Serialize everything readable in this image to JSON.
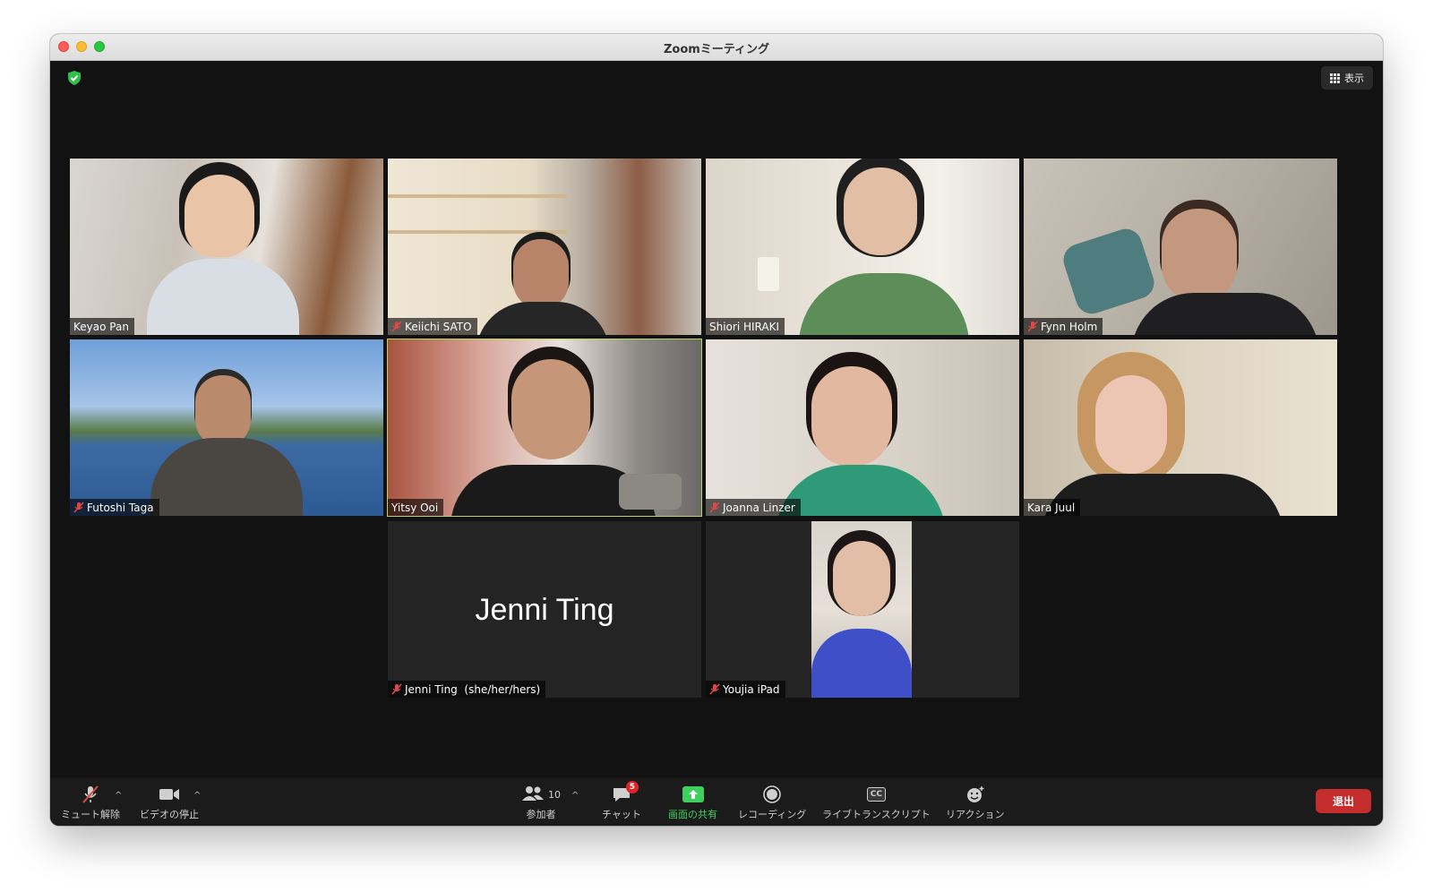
{
  "window": {
    "title": "Zoomミーティング"
  },
  "top": {
    "view_label": "表示"
  },
  "participants_tiles": [
    {
      "name": "Keyao Pan",
      "muted": false
    },
    {
      "name": "Keiichi SATO",
      "muted": true
    },
    {
      "name": "Shiori HIRAKI",
      "muted": false
    },
    {
      "name": "Fynn Holm",
      "muted": true
    },
    {
      "name": "Futoshi Taga",
      "muted": true
    },
    {
      "name": "Yitsy Ooi",
      "muted": false,
      "speaking": true
    },
    {
      "name": "Joanna Linzer",
      "muted": true
    },
    {
      "name": "Kara Juul",
      "muted": false
    },
    {
      "name": "Jenni Ting  (she/her/hers)",
      "display_name": "Jenni Ting",
      "muted": true,
      "video_off": true
    },
    {
      "name": "Youjia iPad",
      "muted": true
    }
  ],
  "toolbar": {
    "unmute": "ミュート解除",
    "stop_video": "ビデオの停止",
    "participants": "参加者",
    "participants_count": "10",
    "chat": "チャット",
    "chat_badge": "5",
    "share_screen": "画面の共有",
    "record": "レコーディング",
    "live_transcript": "ライブトランスクリプト",
    "cc": "CC",
    "reactions": "リアクション",
    "leave": "退出"
  },
  "colors": {
    "speaking_border": "#b9d46b",
    "share_green": "#3ecf5e",
    "leave_red": "#c52d2d",
    "security_green": "#2fbf4a"
  }
}
